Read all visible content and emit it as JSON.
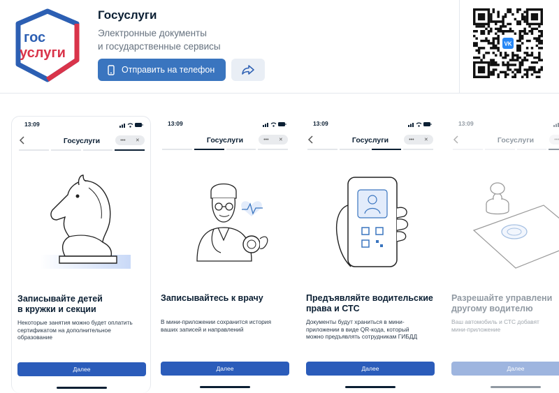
{
  "app": {
    "title": "Госуслуги",
    "subtitle_line1": "Электронные документы",
    "subtitle_line2": "и государственные сервисы",
    "logo_line1": "гос",
    "logo_line2": "услуги",
    "send_button": "Отправить на телефон",
    "share_icon": "share-arrow-icon",
    "qr_badge": "VK"
  },
  "colors": {
    "brand_blue": "#3a75bf",
    "brand_red": "#d9344a",
    "logo_blue": "#2c5fb3",
    "action_blue": "#2b5cba",
    "text_dark": "#0b1f33",
    "text_muted": "#66727f"
  },
  "screens": [
    {
      "time": "13:09",
      "nav_title": "Госуслуги",
      "menu": "•••",
      "close": "✕",
      "heading_line1": "Записывайте детей",
      "heading_line2": "в кружки и секции",
      "desc_line1": "Некоторые занятия можно будет оплатить",
      "desc_line2": "сертификатом на дополнительное",
      "desc_line3": "образование",
      "button": "Далее",
      "illustration": "chess-knight"
    },
    {
      "time": "13:09",
      "nav_title": "Госуслуги",
      "menu": "•••",
      "close": "✕",
      "heading_line1": "Записывайтесь к врачу",
      "heading_line2": "",
      "desc_line1": "В мини-приложении сохранится история",
      "desc_line2": "ваших записей и направлений",
      "desc_line3": "",
      "button": "Далее",
      "illustration": "doctor"
    },
    {
      "time": "13:09",
      "nav_title": "Госуслуги",
      "menu": "•••",
      "close": "✕",
      "heading_line1": "Предъявляйте водительские",
      "heading_line2": "права и СТС",
      "desc_line1": "Документы будут храниться в мини-",
      "desc_line2": "приложении в виде QR-кода, который",
      "desc_line3": "можно предъявлять сотрудникам ГИБДД",
      "button": "Далее",
      "illustration": "phone-qr-document"
    },
    {
      "time": "13:09",
      "nav_title": "Госуслуги",
      "menu": "•••",
      "close": "✕",
      "heading_line1": "Разрешайте управлени",
      "heading_line2": "другому водителю",
      "desc_line1": "Ваш автомобиль и СТС добавят",
      "desc_line2": "мини-приложение",
      "desc_line3": "",
      "button": "Далее",
      "illustration": "stamp-document"
    }
  ]
}
